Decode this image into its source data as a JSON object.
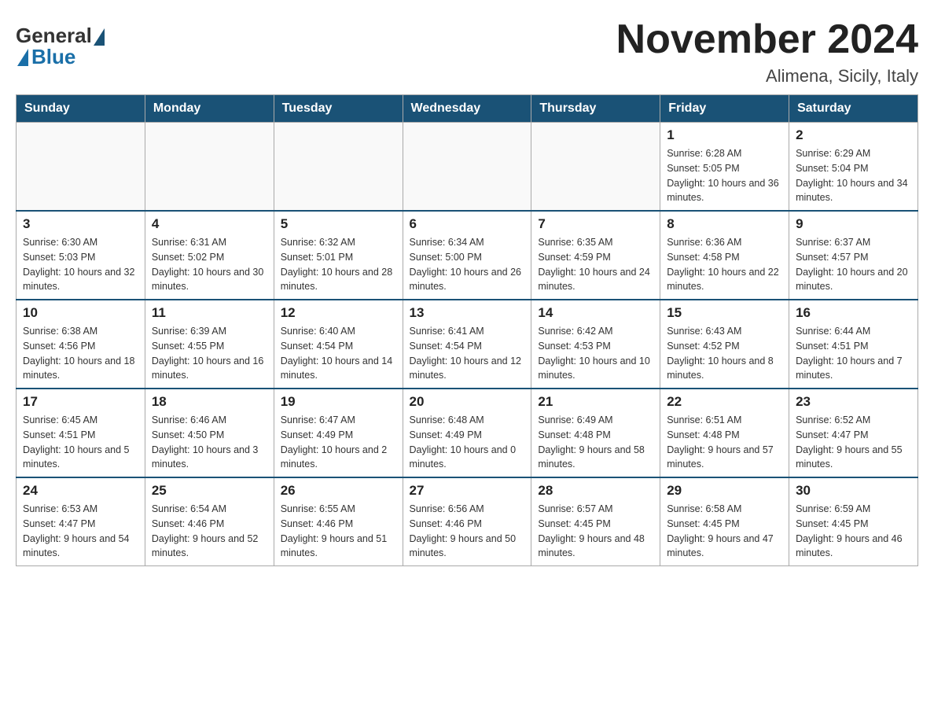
{
  "header": {
    "logo": {
      "general": "General",
      "blue": "Blue"
    },
    "title": "November 2024",
    "location": "Alimena, Sicily, Italy"
  },
  "weekdays": [
    "Sunday",
    "Monday",
    "Tuesday",
    "Wednesday",
    "Thursday",
    "Friday",
    "Saturday"
  ],
  "weeks": [
    [
      {
        "day": "",
        "info": ""
      },
      {
        "day": "",
        "info": ""
      },
      {
        "day": "",
        "info": ""
      },
      {
        "day": "",
        "info": ""
      },
      {
        "day": "",
        "info": ""
      },
      {
        "day": "1",
        "info": "Sunrise: 6:28 AM\nSunset: 5:05 PM\nDaylight: 10 hours and 36 minutes."
      },
      {
        "day": "2",
        "info": "Sunrise: 6:29 AM\nSunset: 5:04 PM\nDaylight: 10 hours and 34 minutes."
      }
    ],
    [
      {
        "day": "3",
        "info": "Sunrise: 6:30 AM\nSunset: 5:03 PM\nDaylight: 10 hours and 32 minutes."
      },
      {
        "day": "4",
        "info": "Sunrise: 6:31 AM\nSunset: 5:02 PM\nDaylight: 10 hours and 30 minutes."
      },
      {
        "day": "5",
        "info": "Sunrise: 6:32 AM\nSunset: 5:01 PM\nDaylight: 10 hours and 28 minutes."
      },
      {
        "day": "6",
        "info": "Sunrise: 6:34 AM\nSunset: 5:00 PM\nDaylight: 10 hours and 26 minutes."
      },
      {
        "day": "7",
        "info": "Sunrise: 6:35 AM\nSunset: 4:59 PM\nDaylight: 10 hours and 24 minutes."
      },
      {
        "day": "8",
        "info": "Sunrise: 6:36 AM\nSunset: 4:58 PM\nDaylight: 10 hours and 22 minutes."
      },
      {
        "day": "9",
        "info": "Sunrise: 6:37 AM\nSunset: 4:57 PM\nDaylight: 10 hours and 20 minutes."
      }
    ],
    [
      {
        "day": "10",
        "info": "Sunrise: 6:38 AM\nSunset: 4:56 PM\nDaylight: 10 hours and 18 minutes."
      },
      {
        "day": "11",
        "info": "Sunrise: 6:39 AM\nSunset: 4:55 PM\nDaylight: 10 hours and 16 minutes."
      },
      {
        "day": "12",
        "info": "Sunrise: 6:40 AM\nSunset: 4:54 PM\nDaylight: 10 hours and 14 minutes."
      },
      {
        "day": "13",
        "info": "Sunrise: 6:41 AM\nSunset: 4:54 PM\nDaylight: 10 hours and 12 minutes."
      },
      {
        "day": "14",
        "info": "Sunrise: 6:42 AM\nSunset: 4:53 PM\nDaylight: 10 hours and 10 minutes."
      },
      {
        "day": "15",
        "info": "Sunrise: 6:43 AM\nSunset: 4:52 PM\nDaylight: 10 hours and 8 minutes."
      },
      {
        "day": "16",
        "info": "Sunrise: 6:44 AM\nSunset: 4:51 PM\nDaylight: 10 hours and 7 minutes."
      }
    ],
    [
      {
        "day": "17",
        "info": "Sunrise: 6:45 AM\nSunset: 4:51 PM\nDaylight: 10 hours and 5 minutes."
      },
      {
        "day": "18",
        "info": "Sunrise: 6:46 AM\nSunset: 4:50 PM\nDaylight: 10 hours and 3 minutes."
      },
      {
        "day": "19",
        "info": "Sunrise: 6:47 AM\nSunset: 4:49 PM\nDaylight: 10 hours and 2 minutes."
      },
      {
        "day": "20",
        "info": "Sunrise: 6:48 AM\nSunset: 4:49 PM\nDaylight: 10 hours and 0 minutes."
      },
      {
        "day": "21",
        "info": "Sunrise: 6:49 AM\nSunset: 4:48 PM\nDaylight: 9 hours and 58 minutes."
      },
      {
        "day": "22",
        "info": "Sunrise: 6:51 AM\nSunset: 4:48 PM\nDaylight: 9 hours and 57 minutes."
      },
      {
        "day": "23",
        "info": "Sunrise: 6:52 AM\nSunset: 4:47 PM\nDaylight: 9 hours and 55 minutes."
      }
    ],
    [
      {
        "day": "24",
        "info": "Sunrise: 6:53 AM\nSunset: 4:47 PM\nDaylight: 9 hours and 54 minutes."
      },
      {
        "day": "25",
        "info": "Sunrise: 6:54 AM\nSunset: 4:46 PM\nDaylight: 9 hours and 52 minutes."
      },
      {
        "day": "26",
        "info": "Sunrise: 6:55 AM\nSunset: 4:46 PM\nDaylight: 9 hours and 51 minutes."
      },
      {
        "day": "27",
        "info": "Sunrise: 6:56 AM\nSunset: 4:46 PM\nDaylight: 9 hours and 50 minutes."
      },
      {
        "day": "28",
        "info": "Sunrise: 6:57 AM\nSunset: 4:45 PM\nDaylight: 9 hours and 48 minutes."
      },
      {
        "day": "29",
        "info": "Sunrise: 6:58 AM\nSunset: 4:45 PM\nDaylight: 9 hours and 47 minutes."
      },
      {
        "day": "30",
        "info": "Sunrise: 6:59 AM\nSunset: 4:45 PM\nDaylight: 9 hours and 46 minutes."
      }
    ]
  ]
}
